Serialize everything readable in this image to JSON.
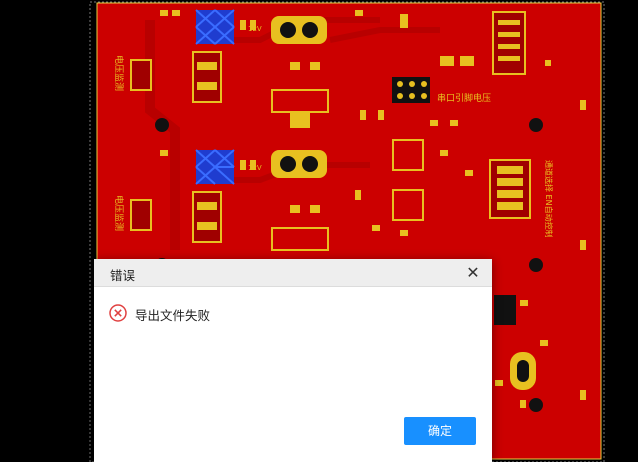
{
  "colors": {
    "board_background": "#000000",
    "pcb_copper": "#cc0000",
    "pcb_trace": "#e8c020",
    "dialog_accent": "#1890ff",
    "error_red": "#e04040"
  },
  "pcb": {
    "silkscreen": {
      "serial_label": "串口引脚电压",
      "side_label_1": "电压监测",
      "side_label_2": "电压监测",
      "right_label": "通道选择 EN自动控制",
      "net_12v_a": "12V",
      "net_12v_b": "12V"
    }
  },
  "dialog": {
    "title": "错误",
    "close_symbol": "✕",
    "message": "导出文件失败",
    "ok_label": "确定",
    "icon": "error-circle-icon"
  }
}
